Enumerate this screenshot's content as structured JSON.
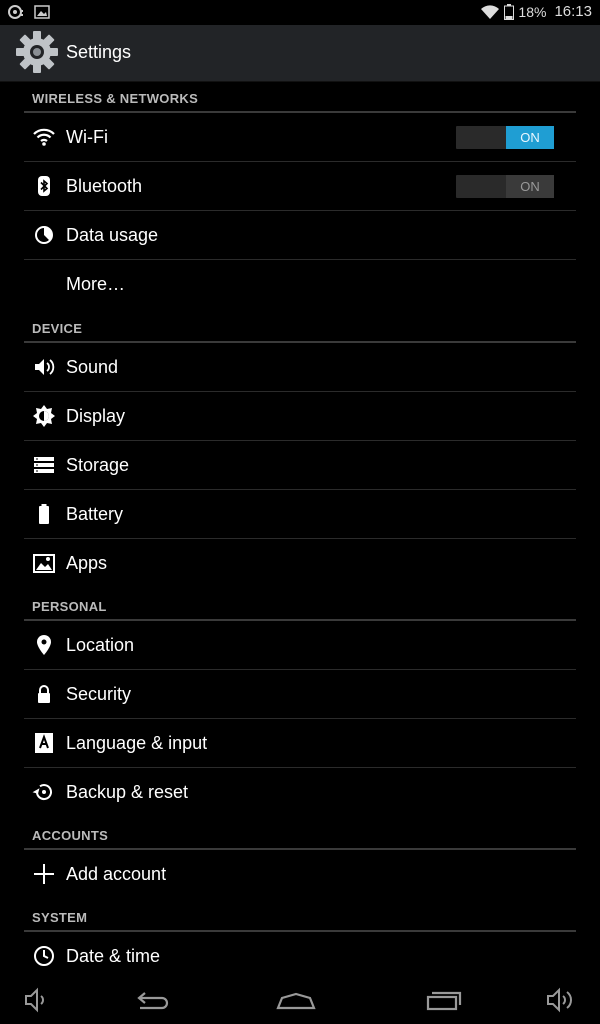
{
  "status_bar": {
    "battery_percent": "18%",
    "time": "16:13",
    "icons": [
      "spinner-notification-icon",
      "image-notification-icon",
      "wifi-icon",
      "battery-icon"
    ]
  },
  "action_bar": {
    "title": "Settings",
    "icon": "settings-gear-icon"
  },
  "sections": {
    "wireless": {
      "header": "WIRELESS & NETWORKS",
      "wifi": {
        "label": "Wi-Fi",
        "icon": "wifi-icon",
        "toggle": "ON",
        "state": "on"
      },
      "bluetooth": {
        "label": "Bluetooth",
        "icon": "bluetooth-icon",
        "toggle": "ON",
        "state": "off"
      },
      "data_usage": {
        "label": "Data usage",
        "icon": "data-usage-icon"
      },
      "more": {
        "label": "More…"
      }
    },
    "device": {
      "header": "DEVICE",
      "sound": {
        "label": "Sound",
        "icon": "sound-icon"
      },
      "display": {
        "label": "Display",
        "icon": "display-icon"
      },
      "storage": {
        "label": "Storage",
        "icon": "storage-icon"
      },
      "battery": {
        "label": "Battery",
        "icon": "battery-icon"
      },
      "apps": {
        "label": "Apps",
        "icon": "apps-icon"
      }
    },
    "personal": {
      "header": "PERSONAL",
      "location": {
        "label": "Location",
        "icon": "location-pin-icon"
      },
      "security": {
        "label": "Security",
        "icon": "lock-icon"
      },
      "language": {
        "label": "Language & input",
        "icon": "language-icon"
      },
      "backup": {
        "label": "Backup & reset",
        "icon": "backup-restore-icon"
      }
    },
    "accounts": {
      "header": "ACCOUNTS",
      "add_account": {
        "label": "Add account",
        "icon": "plus-icon"
      }
    },
    "system": {
      "header": "SYSTEM",
      "date_time": {
        "label": "Date & time",
        "icon": "clock-icon"
      }
    }
  },
  "nav_bar": {
    "buttons": [
      "volume-down-icon",
      "back-icon",
      "home-icon",
      "recent-apps-icon",
      "volume-up-icon"
    ]
  },
  "colors": {
    "accent": "#1f9ed3",
    "background": "#000000",
    "action_bar": "#222427",
    "divider": "#2b2b2b"
  }
}
